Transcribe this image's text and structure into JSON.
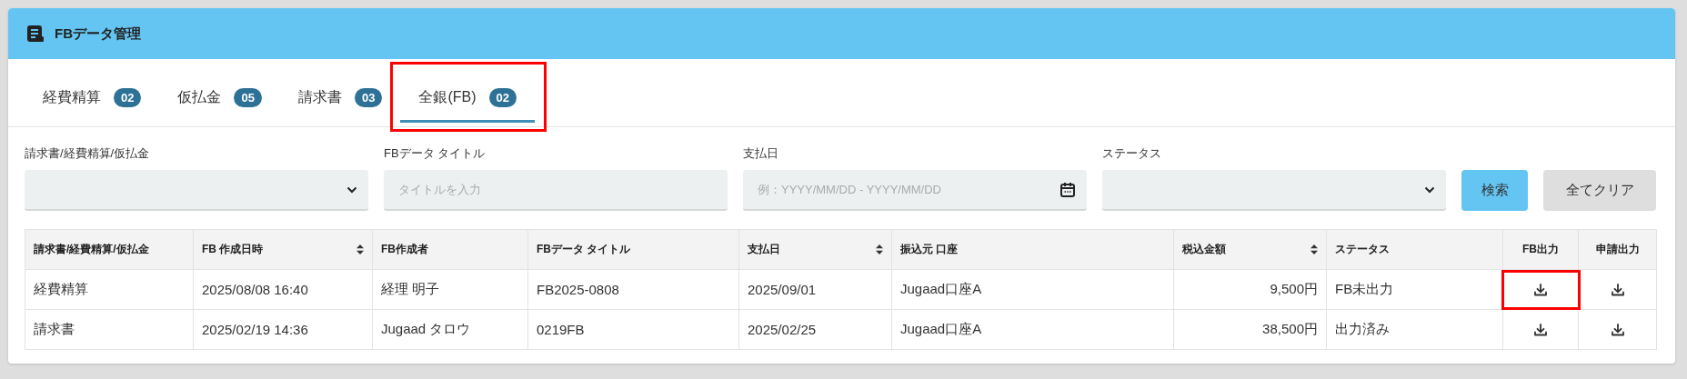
{
  "header": {
    "title": "FBデータ管理"
  },
  "tabs": [
    {
      "label": "経費精算",
      "count": "02",
      "selected": false,
      "highlighted": false
    },
    {
      "label": "仮払金",
      "count": "05",
      "selected": false,
      "highlighted": false
    },
    {
      "label": "請求書",
      "count": "03",
      "selected": false,
      "highlighted": false
    },
    {
      "label": "全銀(FB)",
      "count": "02",
      "selected": true,
      "highlighted": true
    }
  ],
  "filters": [
    {
      "kind": "select",
      "label": "請求書/経費精算/仮払金"
    },
    {
      "kind": "text",
      "label": "FBデータ タイトル",
      "placeholder": "タイトルを入力"
    },
    {
      "kind": "date",
      "label": "支払日",
      "placeholder": "例：YYYY/MM/DD - YYYY/MM/DD"
    },
    {
      "kind": "select",
      "label": "ステータス"
    }
  ],
  "buttons": [
    {
      "label": "検索",
      "kind": "primary"
    },
    {
      "label": "全てクリア",
      "kind": "secondary"
    }
  ],
  "table": {
    "columns": [
      {
        "label": "請求書/経費精算/仮払金",
        "sortable": false,
        "kind": "text"
      },
      {
        "label": "FB 作成日時",
        "sortable": true,
        "kind": "text"
      },
      {
        "label": "FB作成者",
        "sortable": false,
        "kind": "text"
      },
      {
        "label": "FBデータ タイトル",
        "sortable": false,
        "kind": "text"
      },
      {
        "label": "支払日",
        "sortable": true,
        "kind": "text"
      },
      {
        "label": "振込元 口座",
        "sortable": false,
        "kind": "text"
      },
      {
        "label": "税込金額",
        "sortable": true,
        "kind": "amount"
      },
      {
        "label": "ステータス",
        "sortable": false,
        "kind": "text"
      },
      {
        "label": "FB出力",
        "sortable": false,
        "kind": "action"
      },
      {
        "label": "申請出力",
        "sortable": false,
        "kind": "action"
      }
    ],
    "rows": [
      {
        "cells": [
          "経費精算",
          "2025/08/08 16:40",
          "経理 明子",
          "FB2025-0808",
          "2025/09/01",
          "Jugaad口座A",
          "9,500円",
          "FB未出力"
        ],
        "downloads": [
          {
            "highlighted": true
          },
          {
            "highlighted": false
          }
        ]
      },
      {
        "cells": [
          "請求書",
          "2025/02/19 14:36",
          "Jugaad タロウ",
          "0219FB",
          "2025/02/25",
          "Jugaad口座A",
          "38,500円",
          "出力済み"
        ],
        "downloads": [
          {
            "highlighted": false
          },
          {
            "highlighted": false
          }
        ]
      }
    ]
  }
}
